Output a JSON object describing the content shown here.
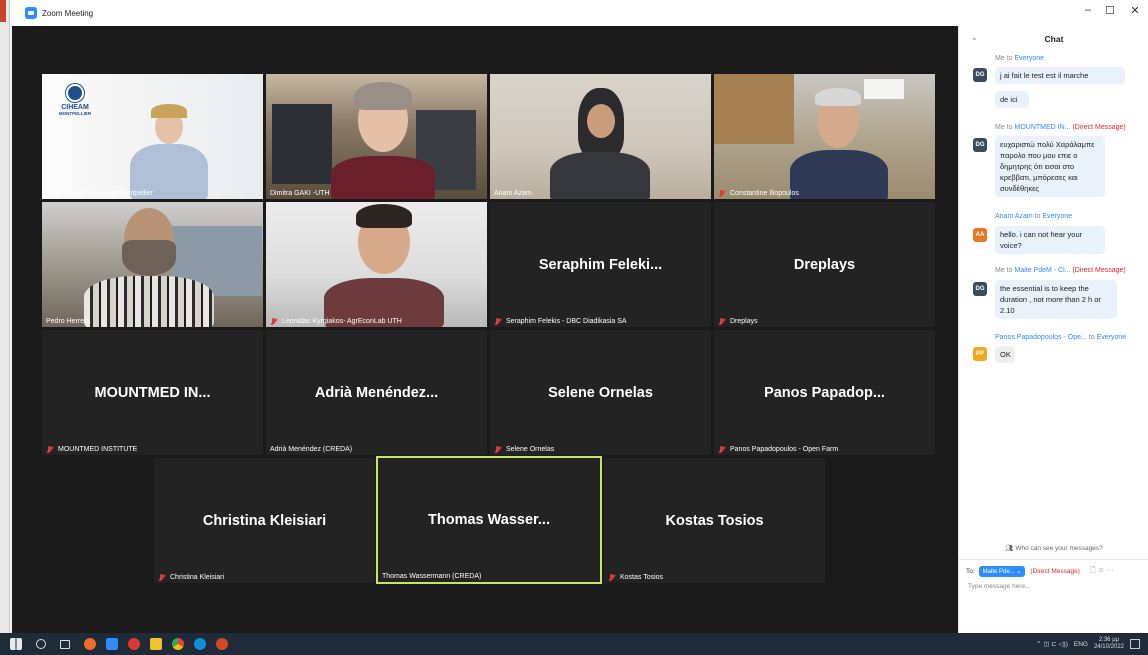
{
  "window": {
    "title": "Zoom Meeting",
    "minimize": "–",
    "maximize": "☐",
    "close": "✕"
  },
  "tiles": [
    {
      "caption": "Maite PdeM - CIHEAM Montpellier",
      "muted": false,
      "logo_lines": [
        "CIHEAM",
        "MONTPELLIER"
      ]
    },
    {
      "caption": "Dimitra GAKI -UTH",
      "muted": false
    },
    {
      "caption": "Anam Azam",
      "muted": false
    },
    {
      "caption": "Constantine Iliopoulos",
      "muted": true
    },
    {
      "caption": "Pedro Herrera",
      "muted": false
    },
    {
      "caption": "Leonidas Kyrgiakos- AgrEconLab UTH",
      "muted": true
    },
    {
      "display": "Seraphim Feleki...",
      "caption": "Seraphim Felekis - DBC Diadikasia SA",
      "muted": true
    },
    {
      "display": "Dreplays",
      "caption": "Dreplays",
      "muted": true
    },
    {
      "display": "MOUNTMED IN...",
      "caption": "MOUNTMED INSTITUTE",
      "muted": true
    },
    {
      "display": "Adrià Menéndez...",
      "caption": "Adrià Menéndez (CREDA)",
      "muted": false
    },
    {
      "display": "Selene Ornelas",
      "caption": "Selene Ornelas",
      "muted": true
    },
    {
      "display": "Panos Papadop...",
      "caption": "Panos Papadopoulos - Open Farm",
      "muted": true
    },
    {
      "display": "Christina Kleisiari",
      "caption": "Christina Kleisiari",
      "muted": true
    },
    {
      "display": "Thomas Wasser...",
      "caption": "Thomas Wassermann (CREDA)",
      "muted": false,
      "active_speaker": true
    },
    {
      "display": "Kostas Tosios",
      "caption": "Kostas Tosios",
      "muted": true
    }
  ],
  "chat": {
    "title": "Chat",
    "collapse_icon": "⌄",
    "messages": [
      {
        "from": "Me",
        "to_word": "to",
        "to": "Everyone",
        "direct": "",
        "avatar": "DG",
        "lines": [
          "j ai fait le test est il marche",
          "de ici"
        ]
      },
      {
        "from": "Me",
        "to_word": "to",
        "to": "MOUNTMED IN...",
        "direct": "(Direct Message)",
        "avatar": "DG",
        "lines": [
          "ευχαριστώ πολύ Χαράλαμπε παρολο που μου επιε ο δημητρης ότι εισαι στο κρεββατι, μπόρεσες και συνδέθηκες"
        ]
      },
      {
        "from": "Anam Azam",
        "to_word": "to",
        "to": "Everyone",
        "direct": "",
        "avatar": "AA",
        "lines": [
          "hello. i can not hear your voice?"
        ]
      },
      {
        "from": "Me",
        "to_word": "to",
        "to": "Maite PdeM - Cl...",
        "direct": "(Direct Message)",
        "avatar": "DG",
        "lines": [
          "the essential is to keep the duration , not more than 2 h or 2.10"
        ]
      },
      {
        "from": "Panos Papadopoulos - Ope...",
        "to_word": "to",
        "to": "Everyone",
        "direct": "",
        "avatar": "PP",
        "lines": [
          "OK"
        ]
      }
    ],
    "who_can_see": "Who can see your messages?",
    "to_label": "To:",
    "recipient": "Maite Pde...",
    "recipient_chevron": "⌄",
    "direct_label": "(Direct Message)",
    "file_icon": "🗋",
    "emoji_icon": "☺",
    "more_icon": "···",
    "placeholder": "Type message here..."
  },
  "taskbar": {
    "language": "ENG",
    "time": "2:36 μμ",
    "date": "24/10/2022",
    "tray": "⌃ ◫ ⊏ ◁))"
  },
  "colors": {
    "stage": "#1a1a1a",
    "tile": "#232323",
    "active_border": "#c3e65a",
    "zoom_blue": "#2d8cff",
    "direct_red": "#e02828"
  }
}
